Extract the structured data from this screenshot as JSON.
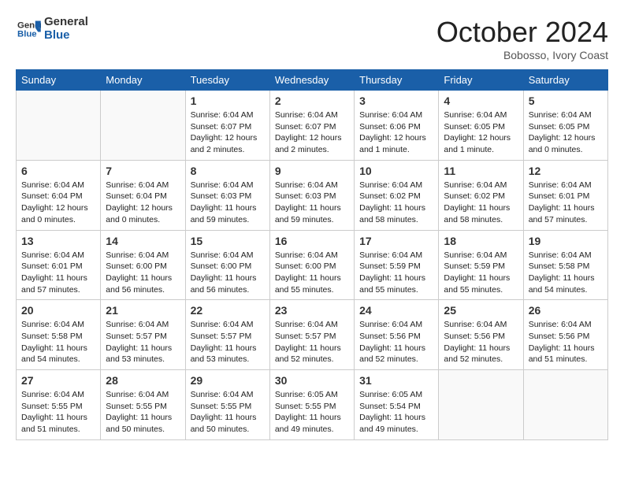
{
  "logo": {
    "text_general": "General",
    "text_blue": "Blue"
  },
  "title": "October 2024",
  "location": "Bobosso, Ivory Coast",
  "days_of_week": [
    "Sunday",
    "Monday",
    "Tuesday",
    "Wednesday",
    "Thursday",
    "Friday",
    "Saturday"
  ],
  "weeks": [
    [
      {
        "day": "",
        "info": ""
      },
      {
        "day": "",
        "info": ""
      },
      {
        "day": "1",
        "info": "Sunrise: 6:04 AM\nSunset: 6:07 PM\nDaylight: 12 hours and 2 minutes."
      },
      {
        "day": "2",
        "info": "Sunrise: 6:04 AM\nSunset: 6:07 PM\nDaylight: 12 hours and 2 minutes."
      },
      {
        "day": "3",
        "info": "Sunrise: 6:04 AM\nSunset: 6:06 PM\nDaylight: 12 hours and 1 minute."
      },
      {
        "day": "4",
        "info": "Sunrise: 6:04 AM\nSunset: 6:05 PM\nDaylight: 12 hours and 1 minute."
      },
      {
        "day": "5",
        "info": "Sunrise: 6:04 AM\nSunset: 6:05 PM\nDaylight: 12 hours and 0 minutes."
      }
    ],
    [
      {
        "day": "6",
        "info": "Sunrise: 6:04 AM\nSunset: 6:04 PM\nDaylight: 12 hours and 0 minutes."
      },
      {
        "day": "7",
        "info": "Sunrise: 6:04 AM\nSunset: 6:04 PM\nDaylight: 12 hours and 0 minutes."
      },
      {
        "day": "8",
        "info": "Sunrise: 6:04 AM\nSunset: 6:03 PM\nDaylight: 11 hours and 59 minutes."
      },
      {
        "day": "9",
        "info": "Sunrise: 6:04 AM\nSunset: 6:03 PM\nDaylight: 11 hours and 59 minutes."
      },
      {
        "day": "10",
        "info": "Sunrise: 6:04 AM\nSunset: 6:02 PM\nDaylight: 11 hours and 58 minutes."
      },
      {
        "day": "11",
        "info": "Sunrise: 6:04 AM\nSunset: 6:02 PM\nDaylight: 11 hours and 58 minutes."
      },
      {
        "day": "12",
        "info": "Sunrise: 6:04 AM\nSunset: 6:01 PM\nDaylight: 11 hours and 57 minutes."
      }
    ],
    [
      {
        "day": "13",
        "info": "Sunrise: 6:04 AM\nSunset: 6:01 PM\nDaylight: 11 hours and 57 minutes."
      },
      {
        "day": "14",
        "info": "Sunrise: 6:04 AM\nSunset: 6:00 PM\nDaylight: 11 hours and 56 minutes."
      },
      {
        "day": "15",
        "info": "Sunrise: 6:04 AM\nSunset: 6:00 PM\nDaylight: 11 hours and 56 minutes."
      },
      {
        "day": "16",
        "info": "Sunrise: 6:04 AM\nSunset: 6:00 PM\nDaylight: 11 hours and 55 minutes."
      },
      {
        "day": "17",
        "info": "Sunrise: 6:04 AM\nSunset: 5:59 PM\nDaylight: 11 hours and 55 minutes."
      },
      {
        "day": "18",
        "info": "Sunrise: 6:04 AM\nSunset: 5:59 PM\nDaylight: 11 hours and 55 minutes."
      },
      {
        "day": "19",
        "info": "Sunrise: 6:04 AM\nSunset: 5:58 PM\nDaylight: 11 hours and 54 minutes."
      }
    ],
    [
      {
        "day": "20",
        "info": "Sunrise: 6:04 AM\nSunset: 5:58 PM\nDaylight: 11 hours and 54 minutes."
      },
      {
        "day": "21",
        "info": "Sunrise: 6:04 AM\nSunset: 5:57 PM\nDaylight: 11 hours and 53 minutes."
      },
      {
        "day": "22",
        "info": "Sunrise: 6:04 AM\nSunset: 5:57 PM\nDaylight: 11 hours and 53 minutes."
      },
      {
        "day": "23",
        "info": "Sunrise: 6:04 AM\nSunset: 5:57 PM\nDaylight: 11 hours and 52 minutes."
      },
      {
        "day": "24",
        "info": "Sunrise: 6:04 AM\nSunset: 5:56 PM\nDaylight: 11 hours and 52 minutes."
      },
      {
        "day": "25",
        "info": "Sunrise: 6:04 AM\nSunset: 5:56 PM\nDaylight: 11 hours and 52 minutes."
      },
      {
        "day": "26",
        "info": "Sunrise: 6:04 AM\nSunset: 5:56 PM\nDaylight: 11 hours and 51 minutes."
      }
    ],
    [
      {
        "day": "27",
        "info": "Sunrise: 6:04 AM\nSunset: 5:55 PM\nDaylight: 11 hours and 51 minutes."
      },
      {
        "day": "28",
        "info": "Sunrise: 6:04 AM\nSunset: 5:55 PM\nDaylight: 11 hours and 50 minutes."
      },
      {
        "day": "29",
        "info": "Sunrise: 6:04 AM\nSunset: 5:55 PM\nDaylight: 11 hours and 50 minutes."
      },
      {
        "day": "30",
        "info": "Sunrise: 6:05 AM\nSunset: 5:55 PM\nDaylight: 11 hours and 49 minutes."
      },
      {
        "day": "31",
        "info": "Sunrise: 6:05 AM\nSunset: 5:54 PM\nDaylight: 11 hours and 49 minutes."
      },
      {
        "day": "",
        "info": ""
      },
      {
        "day": "",
        "info": ""
      }
    ]
  ]
}
